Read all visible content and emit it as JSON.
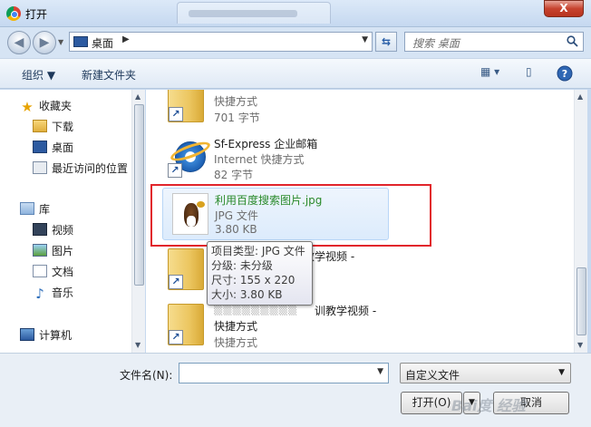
{
  "window": {
    "title": "打开",
    "close_glyph": "X"
  },
  "address": {
    "location": "桌面",
    "separator": "▶",
    "search_placeholder": "搜索 桌面"
  },
  "toolbar": {
    "organize": "组织 ▼",
    "new_folder": "新建文件夹"
  },
  "sidebar": {
    "favorites": "收藏夹",
    "downloads": "下载",
    "desktop": "桌面",
    "recent": "最近访问的位置",
    "libraries": "库",
    "videos": "视频",
    "pictures": "图片",
    "documents": "文档",
    "music": "音乐",
    "computer": "计算机"
  },
  "files": [
    {
      "name": "",
      "type": "快捷方式",
      "size": "701 字节"
    },
    {
      "name": "Sf-Express 企业邮箱",
      "type": "Internet 快捷方式",
      "size": "82 字节"
    },
    {
      "name": "利用百度搜索图片.jpg",
      "type": "JPG 文件",
      "size": "3.80 KB"
    },
    {
      "name": "训教学视频 -",
      "type": "",
      "size": ""
    },
    {
      "name": "训教学视频 -",
      "type": "快捷方式",
      "size": "快捷方式"
    }
  ],
  "tooltip": {
    "line1": "项目类型: JPG 文件",
    "line2": "分级: 未分级",
    "line3": "尺寸: 155 x 220",
    "line4": "大小: 3.80 KB"
  },
  "bottom": {
    "filename_label": "文件名(N):",
    "filename_value": "",
    "filetype": "自定义文件",
    "open": "打开(O)",
    "cancel": "取消"
  },
  "colors": {
    "highlight_box": "#e1252b",
    "selected_name": "#2a8a2a"
  }
}
